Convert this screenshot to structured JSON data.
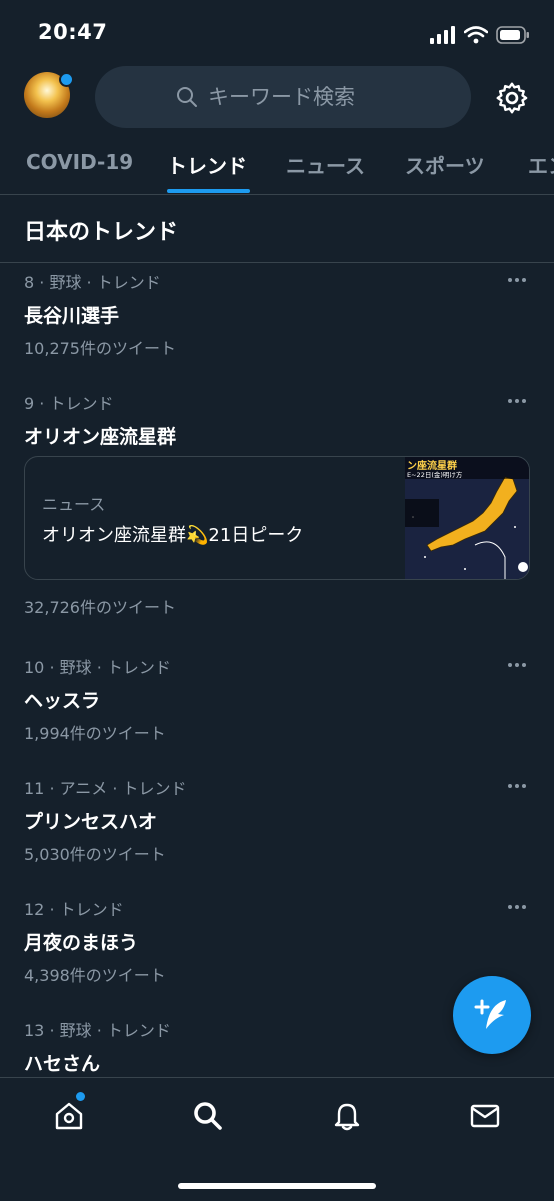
{
  "status_bar": {
    "time": "20:47"
  },
  "header": {
    "search_placeholder": "キーワード検索"
  },
  "tabs": [
    {
      "label": "COVID-19"
    },
    {
      "label": "トレンド"
    },
    {
      "label": "ニュース"
    },
    {
      "label": "スポーツ"
    },
    {
      "label": "エン"
    }
  ],
  "active_tab": "トレンド",
  "section_title": "日本のトレンド",
  "trends": [
    {
      "meta": "8 · 野球 · トレンド",
      "name": "長谷川選手",
      "count": "10,275件のツイート"
    },
    {
      "meta": "9 · トレンド",
      "name": "オリオン座流星群",
      "count": "32,726件のツイート",
      "news": {
        "label": "ニュース",
        "headline": "オリオン座流星群💫21日ピーク",
        "thumb_title": "ン座流星群",
        "thumb_sub": "E~22日(金)明け方"
      }
    },
    {
      "meta": "10 · 野球 · トレンド",
      "name": "ヘッスラ",
      "count": "1,994件のツイート"
    },
    {
      "meta": "11 · アニメ · トレンド",
      "name": "プリンセスハオ",
      "count": "5,030件のツイート"
    },
    {
      "meta": "12 · トレンド",
      "name": "月夜のまほう",
      "count": "4,398件のツイート"
    },
    {
      "meta": "13 · 野球 · トレンド",
      "name": "ハセさん",
      "count": ""
    }
  ],
  "colors": {
    "background": "#15202b",
    "accent": "#1d9bf0",
    "secondary_text": "#8b98a5",
    "divider": "#38444d"
  },
  "icons": {
    "header": [
      "avatar",
      "search-icon",
      "gear-icon"
    ],
    "bottom_nav": [
      "home-icon",
      "search-icon",
      "bell-icon",
      "mail-icon"
    ],
    "fab": "compose-tweet-icon"
  }
}
